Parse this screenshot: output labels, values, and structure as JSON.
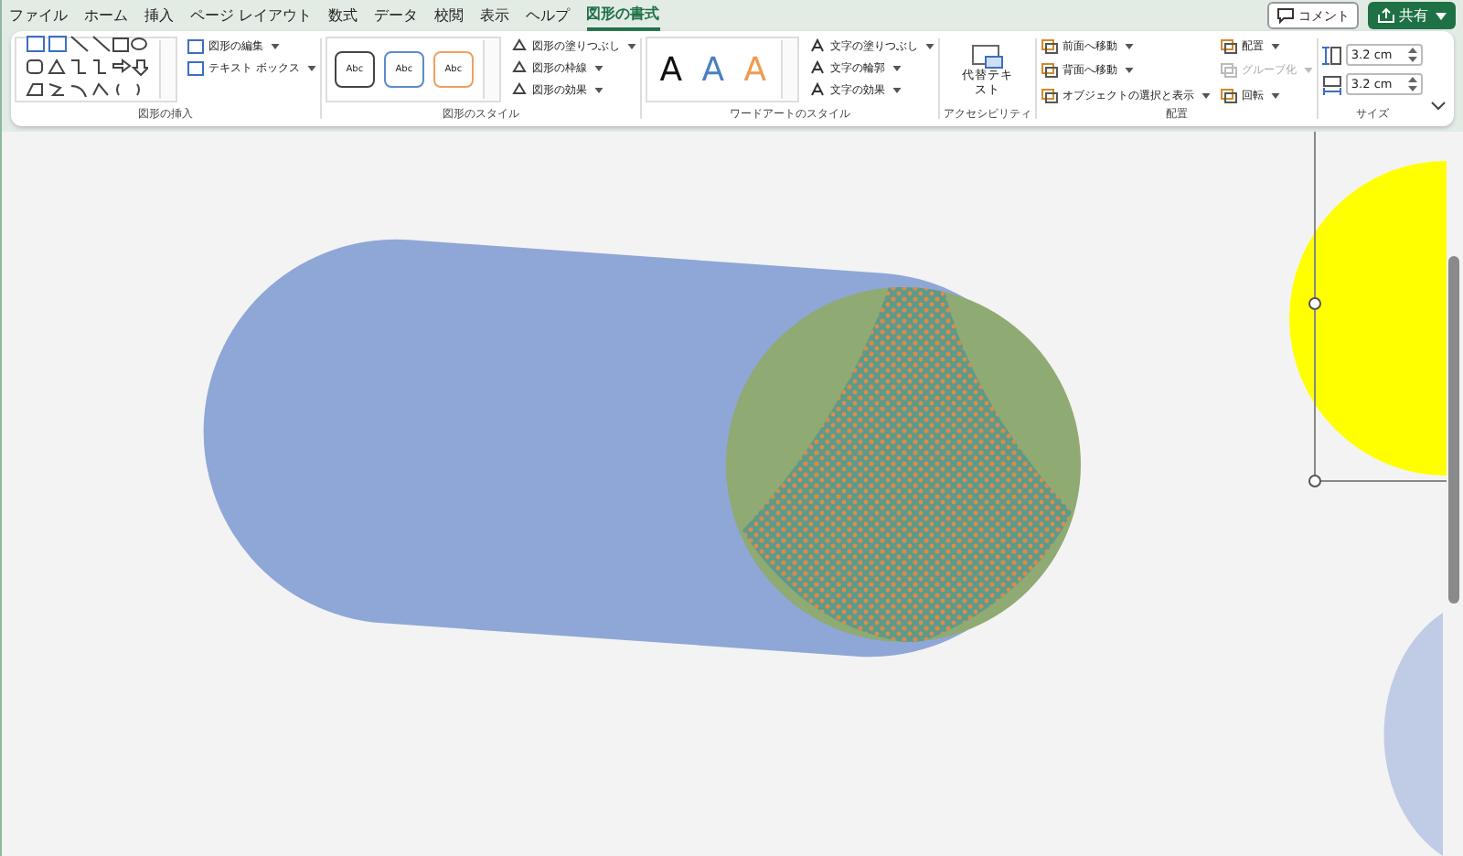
{
  "menu_tabs": [
    {
      "label": "ファイル",
      "selected": false
    },
    {
      "label": "ホーム",
      "selected": false
    },
    {
      "label": "挿入",
      "selected": false
    },
    {
      "label": "ページ レイアウト",
      "selected": false
    },
    {
      "label": "数式",
      "selected": false
    },
    {
      "label": "データ",
      "selected": false
    },
    {
      "label": "校閲",
      "selected": false
    },
    {
      "label": "表示",
      "selected": false
    },
    {
      "label": "ヘルプ",
      "selected": false
    },
    {
      "label": "図形の書式",
      "selected": true
    }
  ],
  "header_buttons": {
    "comment": "コメント",
    "share": "共有"
  },
  "ribbon": {
    "insert_shapes": {
      "label": "図形の挿入",
      "commands": [
        "図形の編集",
        "テキスト ボックス"
      ]
    },
    "shape_styles": {
      "label": "図形のスタイル",
      "presets": [
        {
          "text": "Abc",
          "color": "#444444"
        },
        {
          "text": "Abc",
          "color": "#5b8bd0"
        },
        {
          "text": "Abc",
          "color": "#f0a060"
        }
      ],
      "commands": [
        "図形の塗りつぶし",
        "図形の枠線",
        "図形の効果"
      ]
    },
    "wordart_styles": {
      "label": "ワードアートのスタイル",
      "presets": [
        {
          "text": "A",
          "color": "#111111"
        },
        {
          "text": "A",
          "color": "#4a7fc4"
        },
        {
          "text": "A",
          "color": "#f09a50"
        }
      ],
      "commands": [
        "文字の塗りつぶし",
        "文字の輪郭",
        "文字の効果"
      ]
    },
    "accessibility": {
      "label": "アクセシビリティ",
      "command": "代替テキスト"
    },
    "arrange": {
      "label": "配置",
      "commands": [
        {
          "label": "前面へ移動",
          "disabled": false
        },
        {
          "label": "背面へ移動",
          "disabled": false
        },
        {
          "label": "オブジェクトの選択と表示",
          "disabled": false
        },
        {
          "label": "配置",
          "disabled": false
        },
        {
          "label": "グループ化",
          "disabled": true
        },
        {
          "label": "回転",
          "disabled": false
        }
      ]
    },
    "size": {
      "label": "サイズ",
      "height": "3.2 cm",
      "width": "3.2 cm"
    }
  }
}
